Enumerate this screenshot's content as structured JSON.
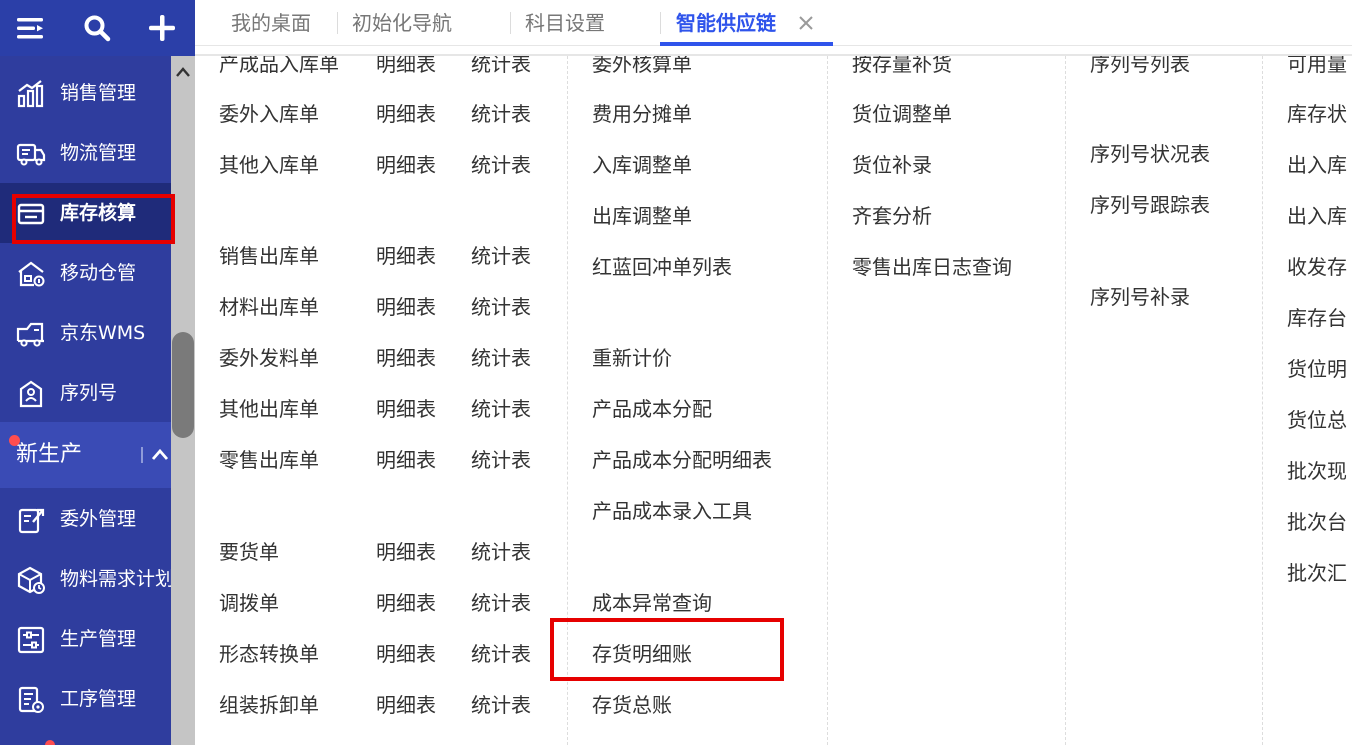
{
  "sidebar": {
    "top_icons": [
      "menu-icon",
      "search-icon",
      "plus-icon"
    ],
    "items": [
      {
        "label": "销售管理",
        "icon": "bar-chart-icon"
      },
      {
        "label": "物流管理",
        "icon": "truck-icon"
      },
      {
        "label": "库存核算",
        "icon": "inventory-box-icon"
      },
      {
        "label": "移动仓管",
        "icon": "mobile-warehouse-icon"
      },
      {
        "label": "京东WMS",
        "icon": "delivery-truck-icon"
      },
      {
        "label": "序列号",
        "icon": "serial-number-icon"
      },
      {
        "label": "委外管理",
        "icon": "outsource-icon"
      },
      {
        "label": "物料需求计划",
        "icon": "material-plan-icon"
      },
      {
        "label": "生产管理",
        "icon": "sliders-icon"
      },
      {
        "label": "工序管理",
        "icon": "process-doc-icon"
      }
    ],
    "group_header": "新生产",
    "colors": {
      "bg": "#2f3d9e",
      "topbar": "#2b3fa8",
      "active": "#1f2b7a",
      "badge": "#ff4d4f"
    }
  },
  "tabs": [
    {
      "label": "我的桌面"
    },
    {
      "label": "初始化导航"
    },
    {
      "label": "科目设置"
    },
    {
      "label": "智能供应链",
      "active": true
    }
  ],
  "menu": {
    "col1": [
      {
        "name": "产成品入库单",
        "detail": "明细表",
        "stats": "统计表"
      },
      {
        "name": "委外入库单",
        "detail": "明细表",
        "stats": "统计表"
      },
      {
        "name": "其他入库单",
        "detail": "明细表",
        "stats": "统计表"
      },
      {
        "name": "销售出库单",
        "detail": "明细表",
        "stats": "统计表"
      },
      {
        "name": "材料出库单",
        "detail": "明细表",
        "stats": "统计表"
      },
      {
        "name": "委外发料单",
        "detail": "明细表",
        "stats": "统计表"
      },
      {
        "name": "其他出库单",
        "detail": "明细表",
        "stats": "统计表"
      },
      {
        "name": "零售出库单",
        "detail": "明细表",
        "stats": "统计表"
      },
      {
        "name": "要货单",
        "detail": "明细表",
        "stats": "统计表"
      },
      {
        "name": "调拨单",
        "detail": "明细表",
        "stats": "统计表"
      },
      {
        "name": "形态转换单",
        "detail": "明细表",
        "stats": "统计表"
      },
      {
        "name": "组装拆卸单",
        "detail": "明细表",
        "stats": "统计表"
      }
    ],
    "col2": [
      "委外核算单",
      "费用分摊单",
      "入库调整单",
      "出库调整单",
      "红蓝回冲单列表",
      "重新计价",
      "产品成本分配",
      "产品成本分配明细表",
      "产品成本录入工具",
      "成本异常查询",
      "存货明细账",
      "存货总账"
    ],
    "col3": [
      "按存量补货",
      "货位调整单",
      "货位补录",
      "齐套分析",
      "零售出库日志查询"
    ],
    "col4": [
      "序列号列表",
      "序列号状况表",
      "序列号跟踪表",
      "序列号补录"
    ],
    "col5": [
      "可用量",
      "库存状",
      "出入库",
      "出入库",
      "收发存",
      "库存台",
      "货位明",
      "货位总",
      "批次现",
      "批次台",
      "批次汇"
    ]
  }
}
